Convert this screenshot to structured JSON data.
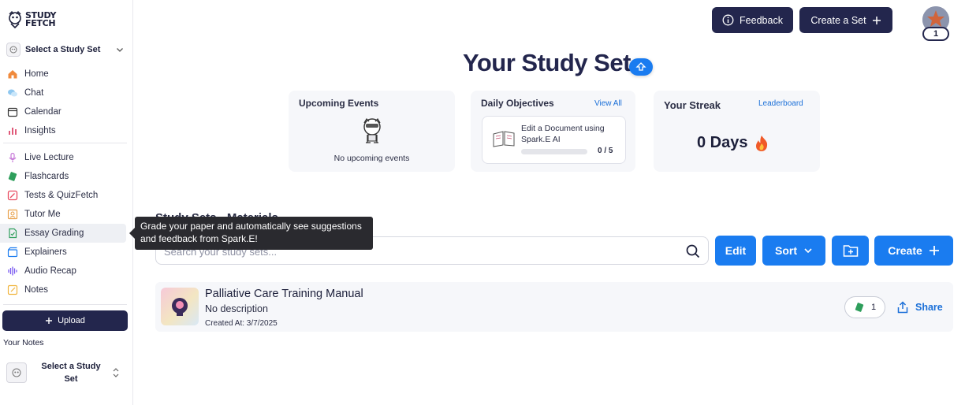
{
  "brand": {
    "line1": "STUDY",
    "line2": "FETCH"
  },
  "sidebar": {
    "set_select_label": "Select a Study Set",
    "nav_primary": [
      {
        "label": "Home",
        "icon": "home-icon"
      },
      {
        "label": "Chat",
        "icon": "chat-icon"
      },
      {
        "label": "Calendar",
        "icon": "calendar-icon"
      },
      {
        "label": "Insights",
        "icon": "insights-icon"
      }
    ],
    "nav_tools": [
      {
        "label": "Live Lecture",
        "icon": "microphone-icon"
      },
      {
        "label": "Flashcards",
        "icon": "flashcards-icon"
      },
      {
        "label": "Tests & QuizFetch",
        "icon": "quiz-icon"
      },
      {
        "label": "Tutor Me",
        "icon": "tutor-icon"
      },
      {
        "label": "Essay Grading",
        "icon": "essay-icon"
      },
      {
        "label": "Explainers",
        "icon": "explainers-icon"
      },
      {
        "label": "Audio Recap",
        "icon": "audio-icon"
      },
      {
        "label": "Notes",
        "icon": "notes-icon"
      }
    ],
    "upload_label": "Upload",
    "your_notes_label": "Your Notes",
    "notes_select_label": "Select a Study Set"
  },
  "header": {
    "feedback_label": "Feedback",
    "create_set_label": "Create a Set",
    "avatar_badge": "1"
  },
  "main": {
    "title": "Your Study Set",
    "upcoming": {
      "title": "Upcoming Events",
      "empty_text": "No upcoming events"
    },
    "objectives": {
      "title": "Daily Objectives",
      "link": "View All",
      "item_text": "Edit a Document using Spark.E AI",
      "progress_text": "0 / 5",
      "progress": 0
    },
    "streak": {
      "title": "Your Streak",
      "link": "Leaderboard",
      "value": "0 Days"
    },
    "section_title": "Study Sets - Materials",
    "search_placeholder": "Search your study sets...",
    "buttons": {
      "edit": "Edit",
      "sort": "Sort",
      "create": "Create"
    },
    "sets": [
      {
        "name": "Palliative Care Training Manual",
        "description": "No description",
        "created": "Created At: 3/7/2025",
        "flashcard_count": "1",
        "share_label": "Share"
      }
    ]
  },
  "tooltip": {
    "text": "Grade your paper and automatically see suggestions and feedback from Spark.E!"
  },
  "colors": {
    "navy": "#23264d",
    "accent_blue": "#1a7cf0",
    "link_blue": "#1a6fd8",
    "card_bg": "#f6f7fa"
  }
}
